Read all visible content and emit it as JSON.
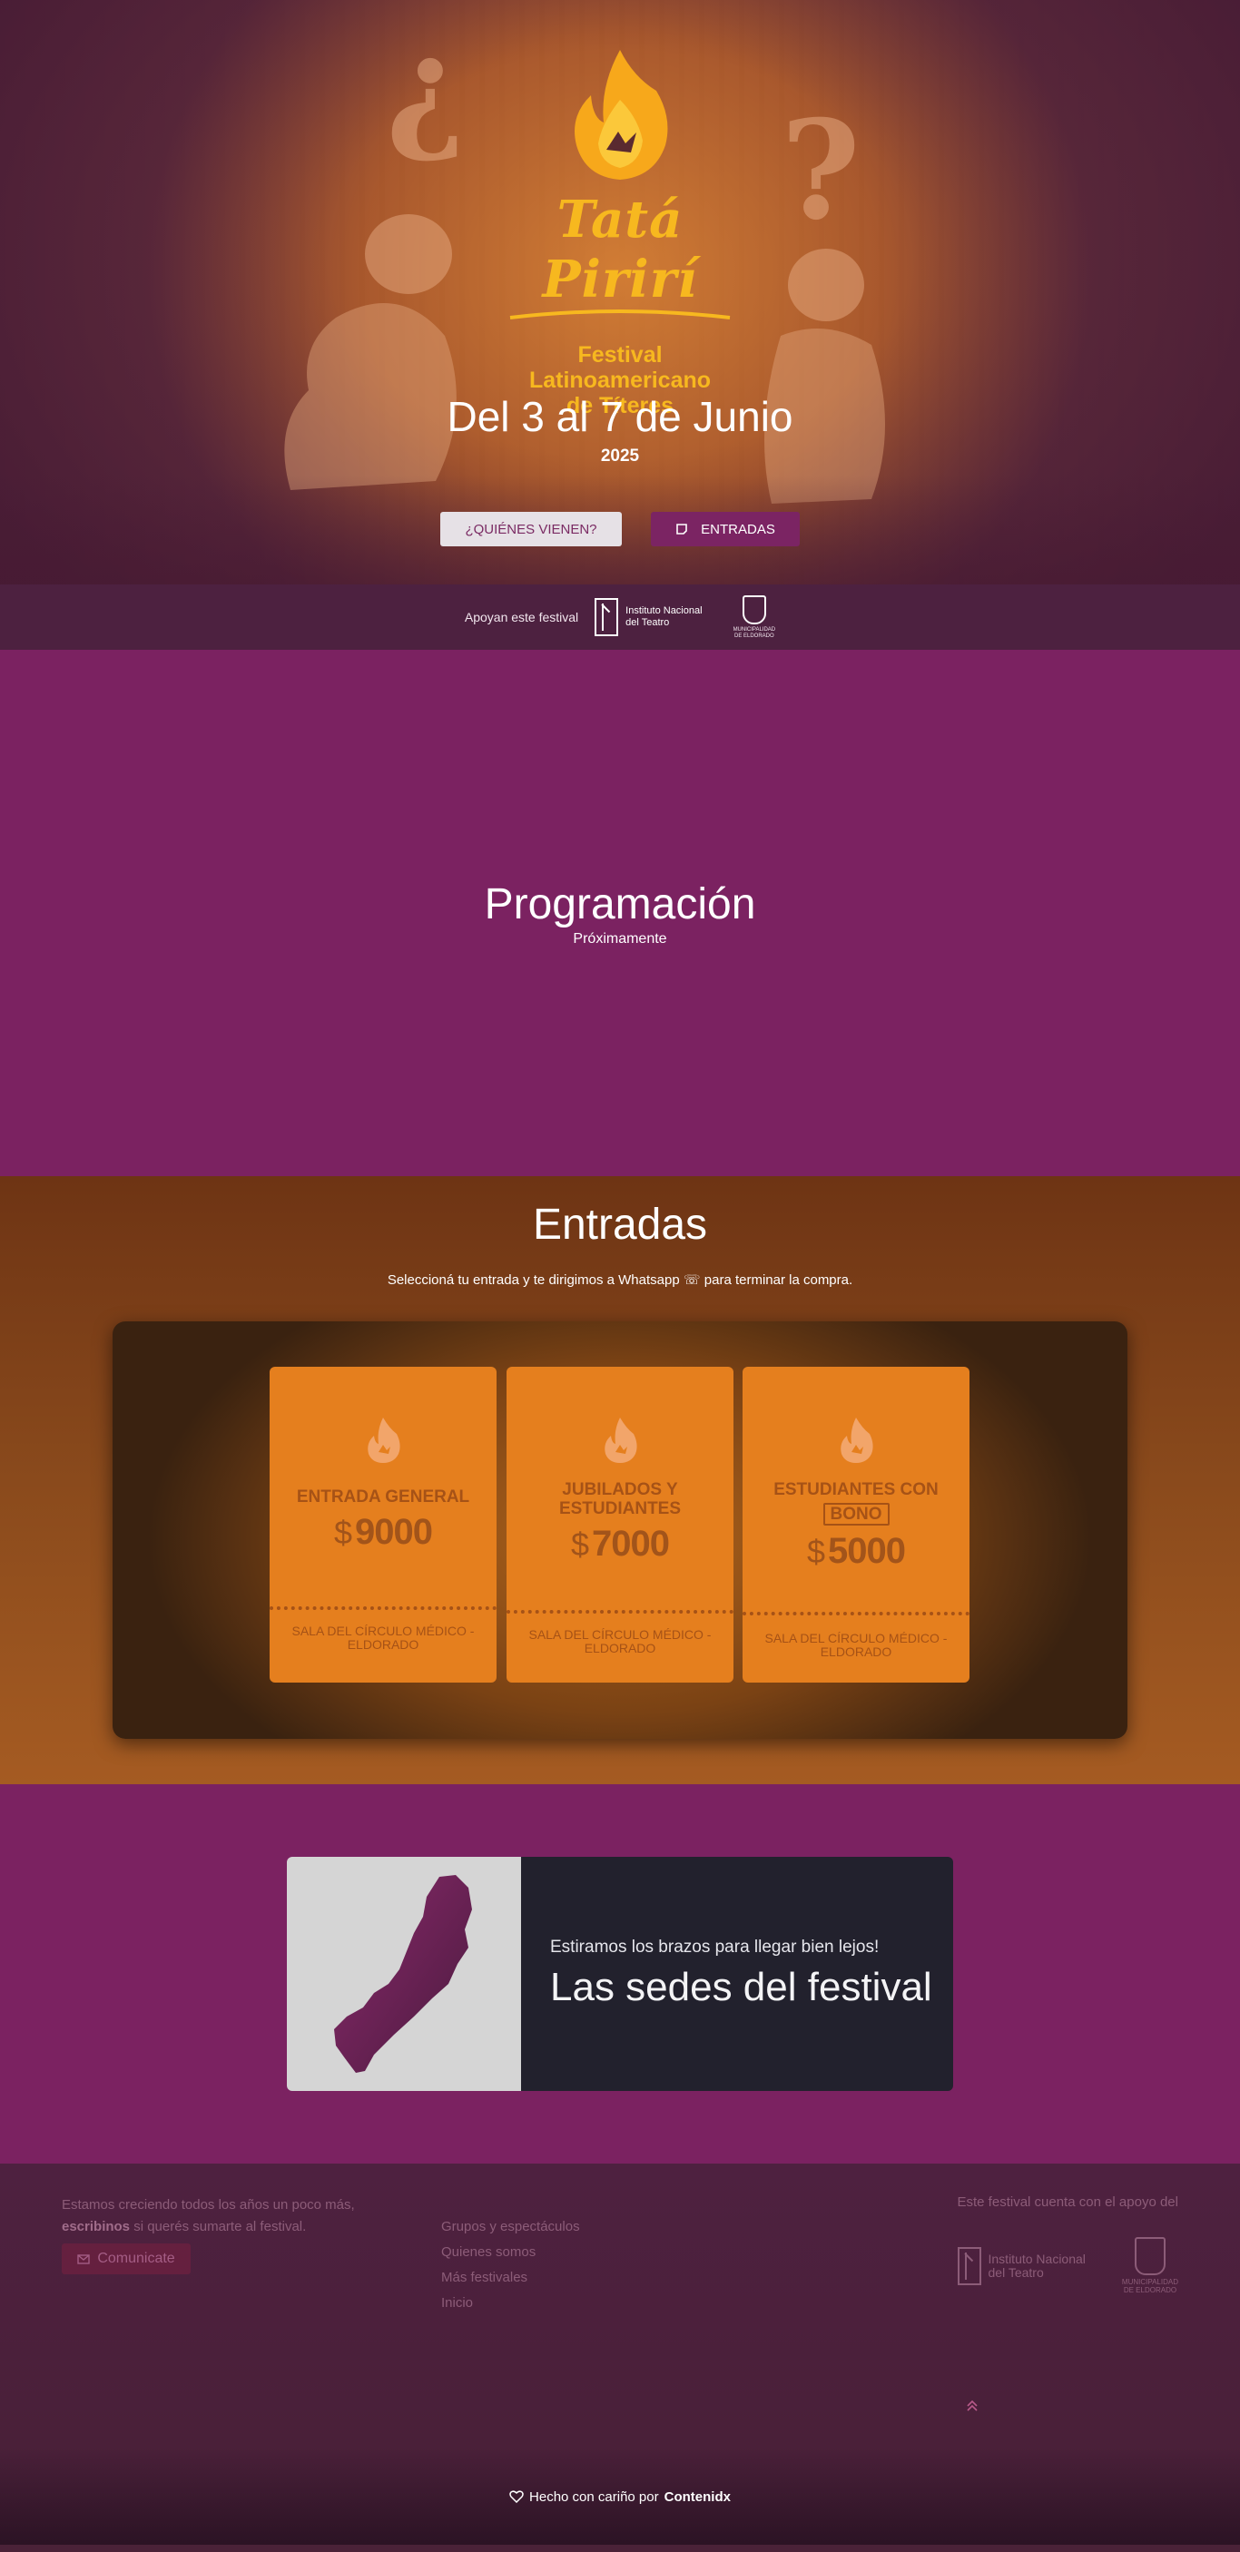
{
  "hero": {
    "logo_title": "Tatá Pirirí",
    "logo_subtitle_line1": "Festival Latinoamericano",
    "logo_subtitle_line2": "de Títeres",
    "date": "Del 3 al 7 de Junio",
    "year": "2025",
    "btn_quienes": "¿QUIÉNES VIENEN?",
    "btn_entradas": "ENTRADAS"
  },
  "support_bar": {
    "label": "Apoyan este festival",
    "inst_line1": "Instituto Nacional",
    "inst_line2": "del Teatro",
    "muni_line1": "MUNICIPALIDAD",
    "muni_line2": "DE ELDORADO"
  },
  "programacion": {
    "title": "Programación",
    "subtitle": "Próximamente"
  },
  "entradas": {
    "title": "Entradas",
    "subtitle": "Seleccioná tu entrada y te dirigimos a Whatsapp ☏ para terminar la compra.",
    "tickets": [
      {
        "name": "ENTRADA GENERAL",
        "currency": "$",
        "price": "9000",
        "venue": "SALA DEL CÍRCULO MÉDICO - ELDORADO"
      },
      {
        "name": "JUBILADOS Y ESTUDIANTES",
        "currency": "$",
        "price": "7000",
        "venue": "SALA DEL CÍRCULO MÉDICO - ELDORADO"
      },
      {
        "name": "ESTUDIANTES CON",
        "badge": "BONO",
        "currency": "$",
        "price": "5000",
        "venue": "SALA DEL CÍRCULO MÉDICO - ELDORADO"
      }
    ]
  },
  "sedes": {
    "lead": "Estiramos los brazos para llegar bien lejos!",
    "title": "Las sedes del festival"
  },
  "footer": {
    "text_part1": "Estamos creciendo todos los años un poco más,",
    "text_bold": "escribinos",
    "text_part2": "si querés sumarte al festival.",
    "btn_comunicate": "Comunicate",
    "links": [
      "Grupos y espectáculos",
      "Quienes somos",
      "Más festivales",
      "Inicio"
    ],
    "support_label": "Este festival cuenta con el apoyo del",
    "inst_line1": "Instituto Nacional",
    "inst_line2": "del Teatro",
    "muni_line1": "MUNICIPALIDAD",
    "muni_line2": "DE ELDORADO",
    "made_with": "Hecho con cariño por",
    "maker": "Contenidx"
  },
  "colors": {
    "brand_purple": "#7b2261",
    "brand_orange": "#e57f1e",
    "logo_yellow": "#f7b81f"
  }
}
